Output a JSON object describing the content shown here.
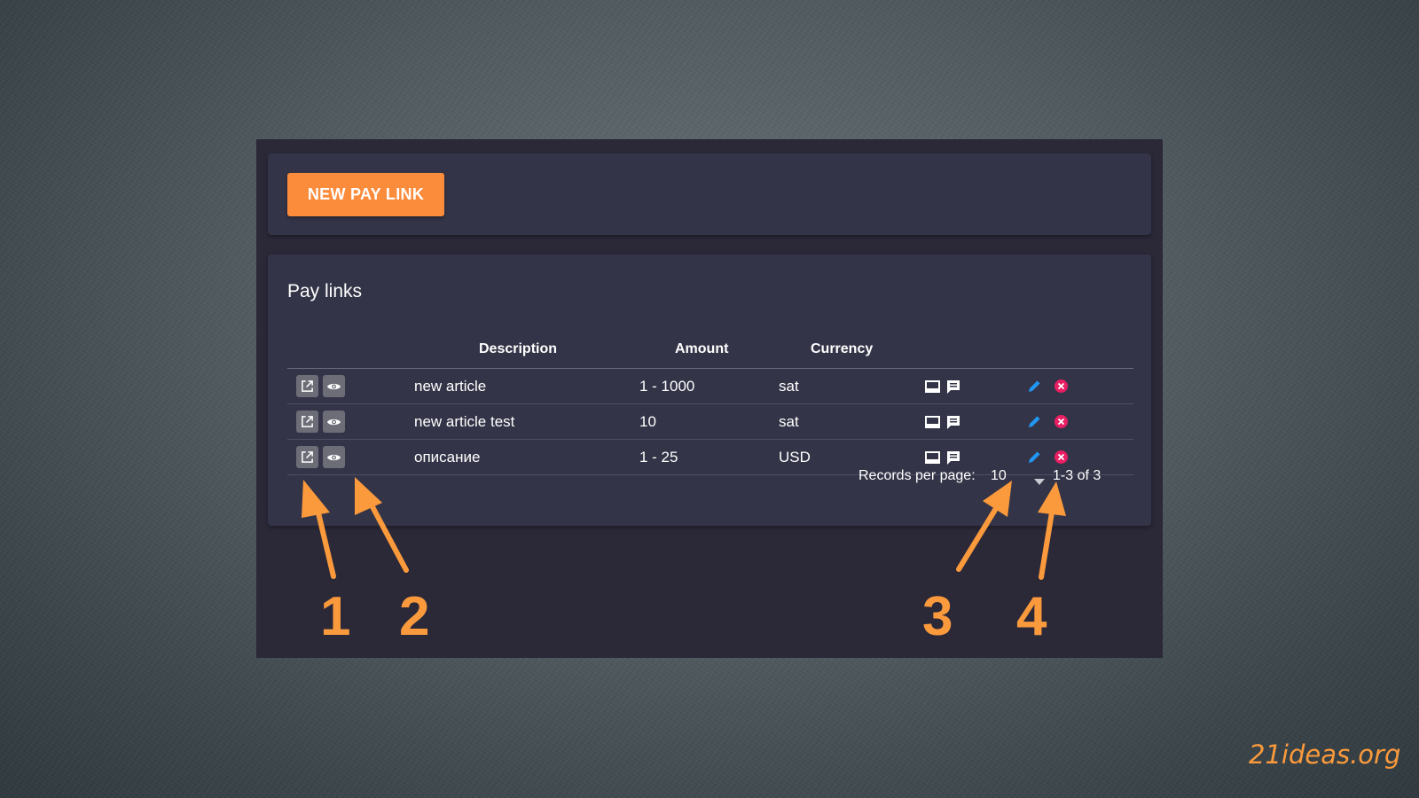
{
  "new_pay_link_label": "NEW PAY LINK",
  "card_title": "Pay links",
  "columns": {
    "description": "Description",
    "amount": "Amount",
    "currency": "Currency"
  },
  "rows": [
    {
      "description": "new article",
      "amount": "1 - 1000",
      "currency": "sat"
    },
    {
      "description": "new article test",
      "amount": "10",
      "currency": "sat"
    },
    {
      "description": "описание",
      "amount": "1 - 25",
      "currency": "USD"
    }
  ],
  "pagination": {
    "records_per_page_label": "Records per page:",
    "records_per_page_value": "10",
    "range": "1-3 of 3"
  },
  "annotations": [
    "1",
    "2",
    "3",
    "4"
  ],
  "watermark": "21ideas.org",
  "colors": {
    "accent": "#fb8c3c",
    "edit": "#2196f3",
    "delete": "#e91e63",
    "panel": "#333447",
    "frame": "#2b2838"
  },
  "icons": [
    "open-link-icon",
    "eye-icon",
    "monitor-icon",
    "comment-icon",
    "pencil-icon",
    "close-circle-icon",
    "chevron-down-icon"
  ]
}
